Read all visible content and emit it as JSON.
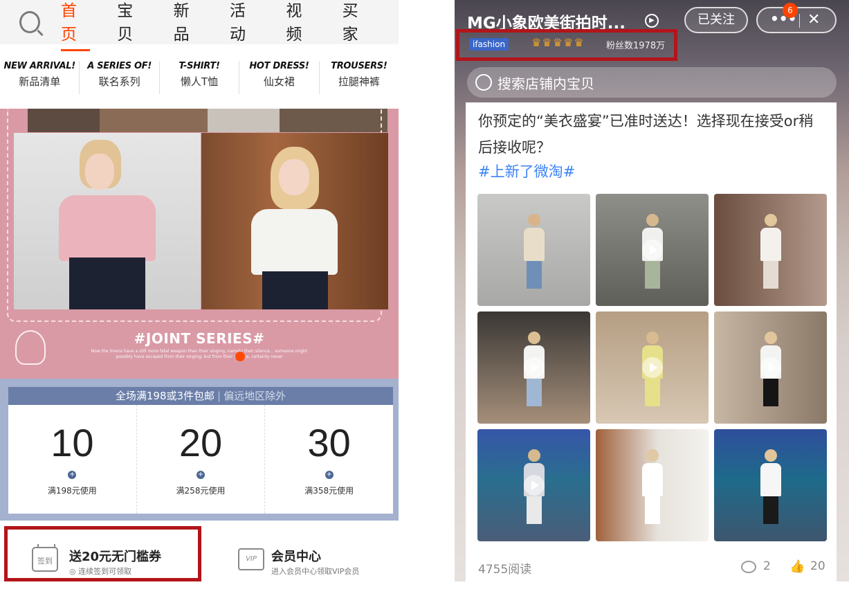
{
  "left": {
    "nav": {
      "search_icon": "search-icon",
      "tabs": [
        {
          "label": "首页",
          "active": true
        },
        {
          "label": "宝贝",
          "active": false
        },
        {
          "label": "新品",
          "active": false
        },
        {
          "label": "活动",
          "active": false
        },
        {
          "label": "视频",
          "active": false
        },
        {
          "label": "买家",
          "active": false
        }
      ]
    },
    "categories": [
      {
        "en": "NEW ARRIVAL!",
        "zh": "新品清单"
      },
      {
        "en": "A SERIES OF!",
        "zh": "联名系列"
      },
      {
        "en": "T-SHIRT!",
        "zh": "懒人T恤"
      },
      {
        "en": "HOT DRESS!",
        "zh": "仙女裙"
      },
      {
        "en": "TROUSERS!",
        "zh": "拉腿神裤"
      }
    ],
    "banner": {
      "title": "#JOINT SERIES#",
      "subtitle": "Now the Sirens have a still more fatal weapon than their singing, namely their silence... someone might possibly have escaped from their singing; but from their silence, certainly never"
    },
    "shipping": {
      "main": "全场满198或3件包邮",
      "separator": "|",
      "note": "偏远地区除外"
    },
    "coupons": [
      {
        "amount": "10",
        "condition": "满198元使用"
      },
      {
        "amount": "20",
        "condition": "满258元使用"
      },
      {
        "amount": "30",
        "condition": "满358元使用"
      }
    ],
    "signin": {
      "icon_label": "签到",
      "title": "送20元无门槛券",
      "subtitle": "连续签到可领取"
    },
    "vip": {
      "icon_label": "VIP",
      "title": "会员中心",
      "subtitle": "进入会员中心领取VIP会员"
    }
  },
  "right": {
    "header": {
      "title": "MG小象欧美街拍时...",
      "follow_label": "已关注",
      "more_label": "•••",
      "badge": "6",
      "close_label": "✕"
    },
    "meta": {
      "brand": "ifashion",
      "crowns": "♛♛♛♛♛",
      "fans": "粉丝数1978万"
    },
    "search": {
      "placeholder": "搜索店铺内宝贝"
    },
    "post": {
      "text": "你预定的“美衣盛宴”已准时送达！选择现在接受or稍后接收呢？",
      "tag": "#上新了微淘#",
      "reads": "4755阅读",
      "comments": "2",
      "likes": "20"
    },
    "grid_video_flags": [
      false,
      true,
      false,
      true,
      true,
      true,
      true,
      true,
      false
    ]
  }
}
